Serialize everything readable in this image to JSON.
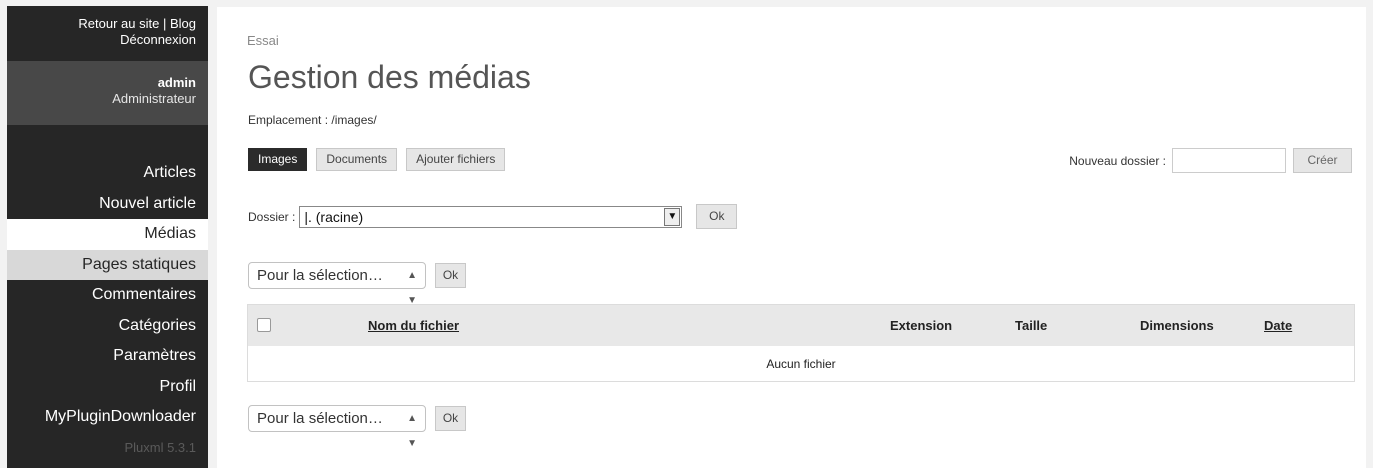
{
  "sidebar": {
    "back_link": "Retour au site",
    "separator": "|",
    "blog_link": "Blog",
    "logout": "Déconnexion",
    "user_name": "admin",
    "user_role": "Administrateur",
    "items": [
      {
        "label": "Articles"
      },
      {
        "label": "Nouvel article"
      },
      {
        "label": "Médias"
      },
      {
        "label": "Pages statiques"
      },
      {
        "label": "Commentaires"
      },
      {
        "label": "Catégories"
      },
      {
        "label": "Paramètres"
      },
      {
        "label": "Profil"
      },
      {
        "label": "MyPluginDownloader"
      }
    ],
    "version": "Pluxml 5.3.1"
  },
  "main": {
    "breadcrumb": "Essai",
    "title": "Gestion des médias",
    "location": "Emplacement : /images/",
    "tabs": [
      {
        "label": "Images"
      },
      {
        "label": "Documents"
      },
      {
        "label": "Ajouter fichiers"
      }
    ],
    "new_folder_label": "Nouveau dossier :",
    "new_folder_value": "",
    "create_button": "Créer",
    "folder_label": "Dossier :",
    "folder_selected": "|. (racine)",
    "folder_ok": "Ok",
    "selection_placeholder": "Pour la sélection…",
    "selection_ok": "Ok",
    "table": {
      "columns": [
        "Nom du fichier",
        "Extension",
        "Taille",
        "Dimensions",
        "Date"
      ],
      "empty_message": "Aucun fichier"
    }
  }
}
